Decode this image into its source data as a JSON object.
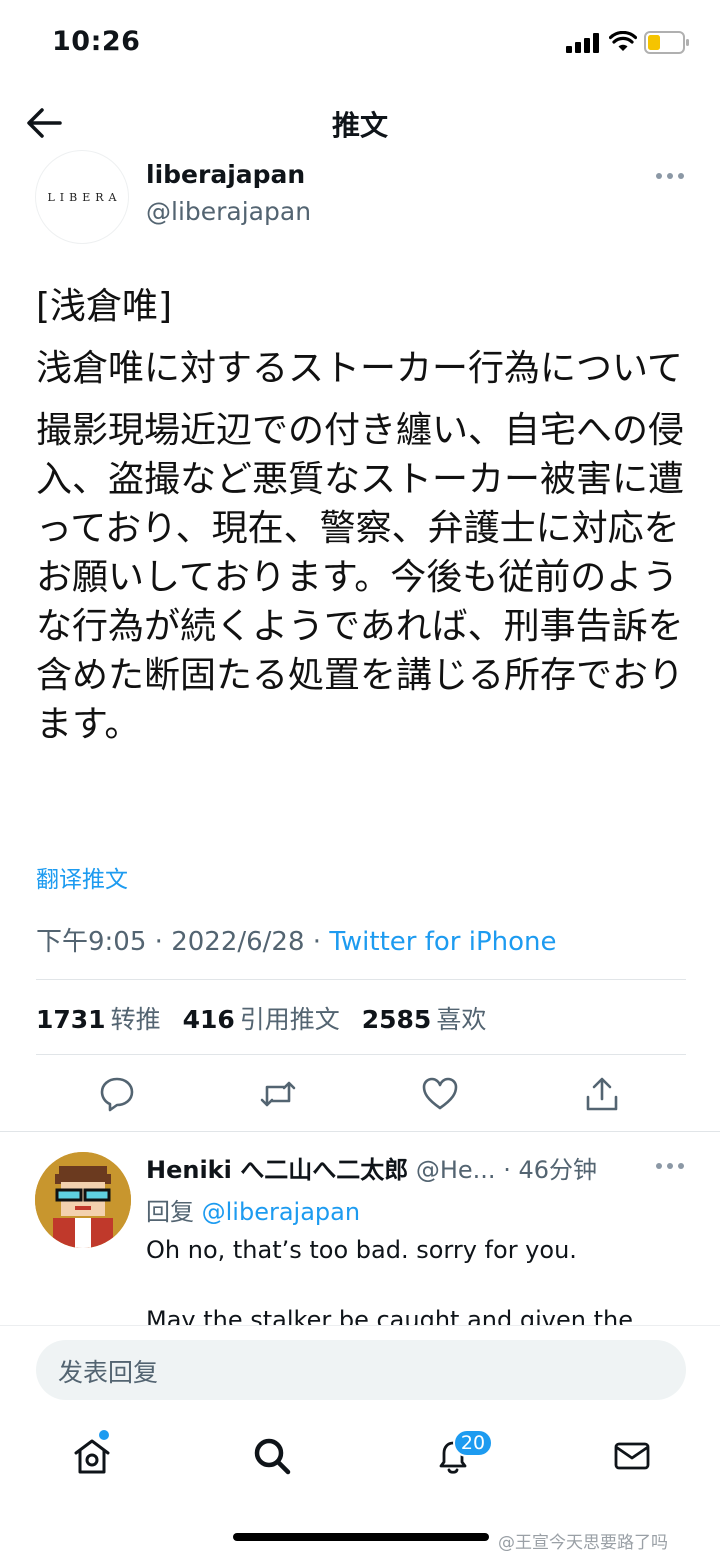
{
  "status_bar": {
    "time": "10:26"
  },
  "header": {
    "title": "推文"
  },
  "author": {
    "avatar_text": "LIBERA",
    "name": "liberajapan",
    "handle": "@liberajapan"
  },
  "tweet": {
    "lines": [
      "[浅倉唯]",
      "浅倉唯に対するストーカー行為について",
      "撮影現場近辺での付き纏い、自宅への侵入、盗撮など悪質なストーカー被害に遭っており、現在、警察、弁護士に対応をお願いしております。今後も従前のような行為が続くようであれば、刑事告訴を含めた断固たる処置を講じる所存でおります。"
    ],
    "translate_label": "翻译推文",
    "time": "下午9:05",
    "date": "2022/6/28",
    "separator": "·",
    "source": "Twitter for iPhone"
  },
  "stats": {
    "retweets_count": "1731",
    "retweets_label": "转推",
    "quotes_count": "416",
    "quotes_label": "引用推文",
    "likes_count": "2585",
    "likes_label": "喜欢"
  },
  "actions": [
    "reply-icon",
    "retweet-icon",
    "like-icon",
    "share-icon"
  ],
  "reply": {
    "name": "Heniki へ二山へ二太郎",
    "handle": "@He...",
    "time": "· 46分钟",
    "reply_to_prefix": "回复",
    "reply_to_handle": "@liberajapan",
    "text": "Oh no, that’s too bad. sorry for you.",
    "text_cutoff": "May the stalker be caught and given the"
  },
  "compose": {
    "placeholder": "发表回复"
  },
  "tab_bar": {
    "items": [
      "home-icon",
      "search-icon",
      "notifications-icon",
      "messages-icon"
    ],
    "notification_badge": "20"
  },
  "watermark": "@王宣今天思要路了吗",
  "colors": {
    "accent": "#1d9bf0",
    "text": "#0f1419",
    "secondary": "#536471"
  }
}
